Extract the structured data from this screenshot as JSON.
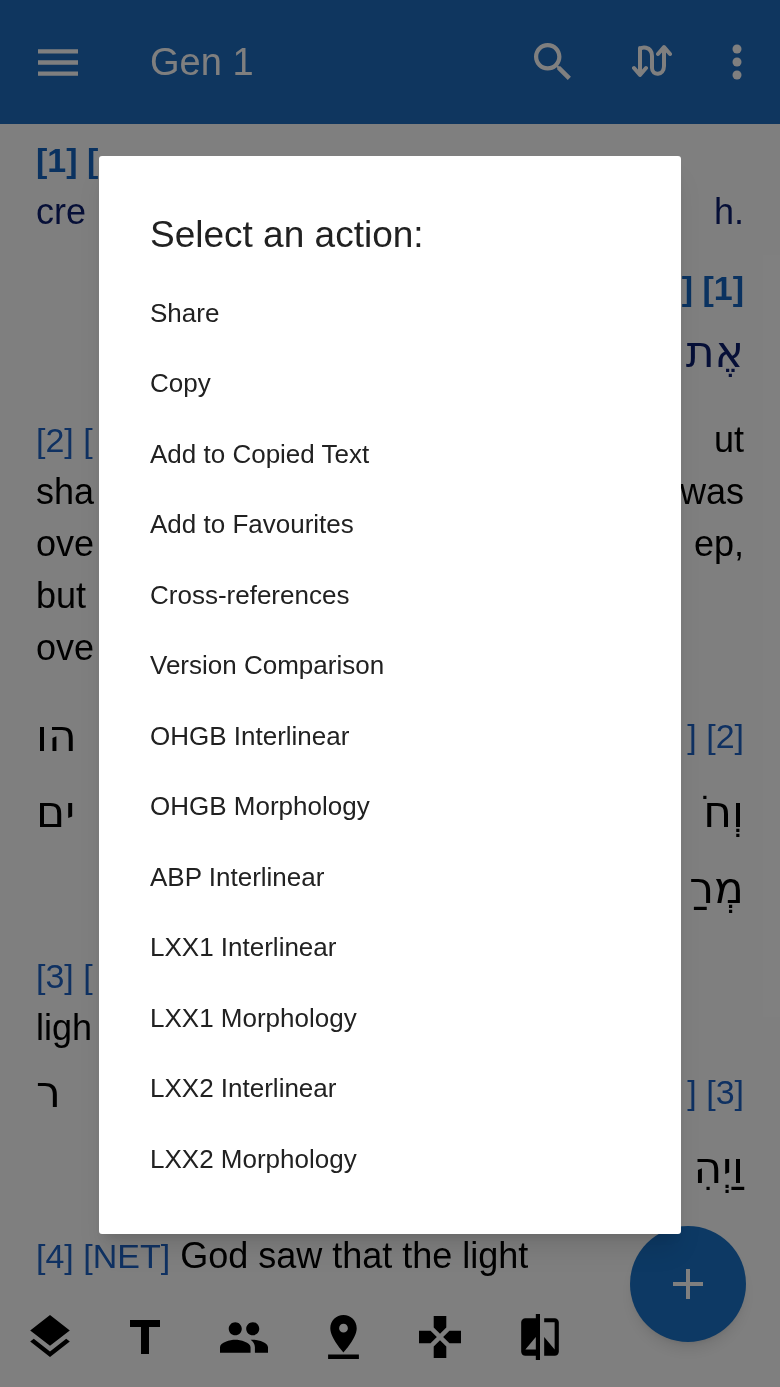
{
  "app_bar": {
    "title": "Gen 1"
  },
  "reader_rows": [
    {
      "gap_before": false,
      "left": [
        {
          "text": "[1] [",
          "kind": "ref_bold"
        }
      ],
      "right": []
    },
    {
      "gap_before": false,
      "left": [
        {
          "text": "cre",
          "kind": "selected_text"
        }
      ],
      "right": [
        {
          "text": "h.",
          "kind": "selected_text"
        }
      ]
    },
    {
      "gap_before": true,
      "left": [],
      "right": [
        {
          "text": "] [1]",
          "kind": "ref_bold"
        }
      ]
    },
    {
      "gap_before": false,
      "left": [],
      "right": [
        {
          "text": "אֶת",
          "kind": "selected_hebrew"
        }
      ]
    },
    {
      "gap_before": true,
      "left": [
        {
          "text": "[2] [",
          "kind": "ref"
        }
      ],
      "right": [
        {
          "text": "ut",
          "kind": "text"
        }
      ]
    },
    {
      "gap_before": false,
      "left": [
        {
          "text": "sha",
          "kind": "text"
        }
      ],
      "right": [
        {
          "text": "was",
          "kind": "text"
        }
      ]
    },
    {
      "gap_before": false,
      "left": [
        {
          "text": "ove",
          "kind": "text"
        }
      ],
      "right": [
        {
          "text": "ep,",
          "kind": "text"
        }
      ]
    },
    {
      "gap_before": false,
      "left": [
        {
          "text": "but",
          "kind": "text"
        }
      ],
      "right": []
    },
    {
      "gap_before": false,
      "left": [
        {
          "text": "ove",
          "kind": "text"
        }
      ],
      "right": []
    },
    {
      "gap_before": true,
      "left": [
        {
          "text": "הו",
          "kind": "hebrew"
        }
      ],
      "right": [
        {
          "text": "] [2]",
          "kind": "ref"
        }
      ]
    },
    {
      "gap_before": false,
      "left": [
        {
          "text": "ים",
          "kind": "hebrew"
        }
      ],
      "right": [
        {
          "text": "וְחֹ",
          "kind": "hebrew"
        }
      ]
    },
    {
      "gap_before": false,
      "left": [],
      "right": [
        {
          "text": "מְרַ",
          "kind": "hebrew"
        }
      ]
    },
    {
      "gap_before": true,
      "left": [
        {
          "text": "[3] [",
          "kind": "ref"
        }
      ],
      "right": []
    },
    {
      "gap_before": false,
      "left": [
        {
          "text": "ligh",
          "kind": "text"
        }
      ],
      "right": []
    },
    {
      "gap_before": false,
      "left": [
        {
          "text": "ר",
          "kind": "hebrew"
        }
      ],
      "right": [
        {
          "text": "] [3]",
          "kind": "ref"
        }
      ]
    },
    {
      "gap_before": false,
      "left": [],
      "right": [
        {
          "text": "וַיְהִ",
          "kind": "hebrew"
        }
      ]
    },
    {
      "gap_before": true,
      "left": [
        {
          "text": "[4] [NET]",
          "kind": "ref"
        },
        {
          "text": " God saw that the light",
          "kind": "text"
        }
      ],
      "right": []
    }
  ],
  "dialog": {
    "title": "Select an action:",
    "items": [
      "Share",
      "Copy",
      "Add to Copied Text",
      "Add to Favourites",
      "Cross-references",
      "Version Comparison",
      "OHGB Interlinear",
      "OHGB Morphology",
      "ABP Interlinear",
      "LXX1 Interlinear",
      "LXX1 Morphology",
      "LXX2 Interlinear",
      "LXX2 Morphology"
    ]
  }
}
